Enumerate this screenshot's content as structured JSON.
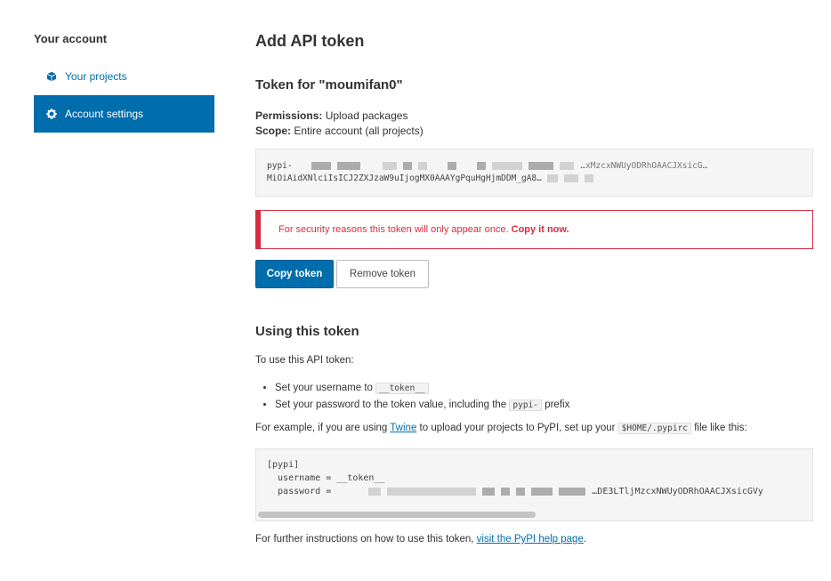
{
  "sidebar": {
    "heading": "Your account",
    "items": [
      {
        "label": "Your projects",
        "icon": "cube-icon",
        "active": false
      },
      {
        "label": "Account settings",
        "icon": "gear-icon",
        "active": true
      }
    ]
  },
  "page": {
    "title": "Add API token",
    "token_heading": "Token for \"moumifan0\"",
    "permissions_label": "Permissions:",
    "permissions_value": "Upload packages",
    "scope_label": "Scope:",
    "scope_value": "Entire account (all projects)"
  },
  "token": {
    "line1_prefix": "pypi-",
    "line1_visible": "…xMzcxNWUyODRhOAACJXsicG…",
    "line2": "MiOiAidXNlciIsICJ2ZXJzaW9uIjogMX0AAAYgPquHgHjmDDM_gA8…"
  },
  "alert": {
    "text": "For security reasons this token will only appear once.",
    "strong": "Copy it now."
  },
  "buttons": {
    "copy": "Copy token",
    "remove": "Remove token"
  },
  "usage": {
    "heading": "Using this token",
    "intro": "To use this API token:",
    "bullet1_text": "Set your username to",
    "bullet1_code": "__token__",
    "bullet2_text": "Set your password to the token value, including the",
    "bullet2_code": "pypi-",
    "bullet2_suffix": "prefix",
    "example_pre": "For example, if you are using",
    "example_link": "Twine",
    "example_mid": "to upload your projects to PyPI, set up your",
    "example_code": "$HOME/.pypirc",
    "example_post": "file like this:",
    "pypirc_line1": "[pypi]",
    "pypirc_line2": "  username = __token__",
    "pypirc_line3_prefix": "  password = ",
    "pypirc_line3_visible": "…DE3LTljMzcxNWUyODRhOAACJXsicGVy",
    "further_pre": "For further instructions on how to use this token,",
    "further_link": "visit the PyPI help page",
    "further_post": "."
  },
  "colors": {
    "accent": "#006dad",
    "danger": "#d52d40"
  }
}
